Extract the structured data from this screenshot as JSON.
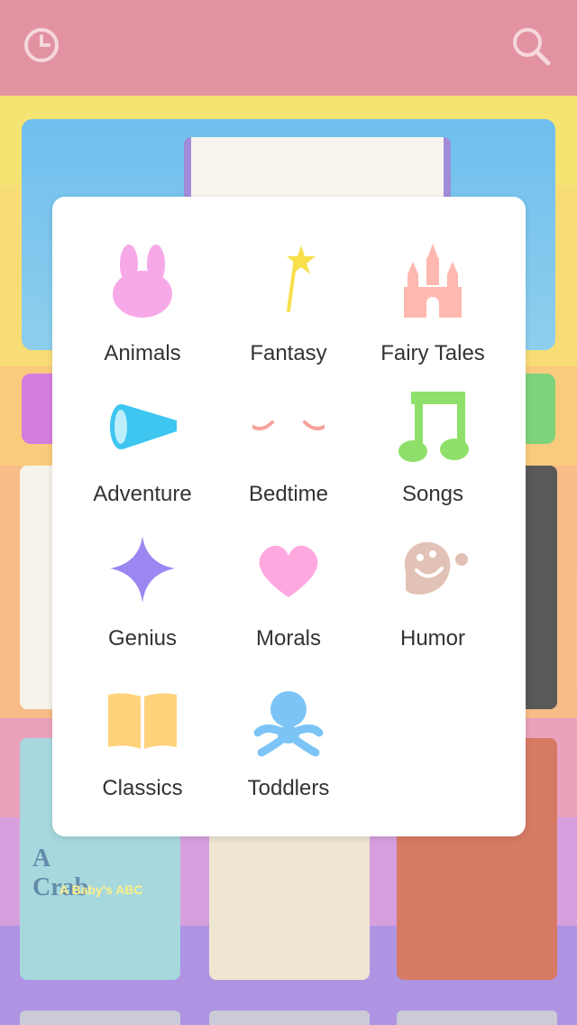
{
  "header": {
    "history_icon": "clock-icon",
    "search_icon": "search-icon"
  },
  "background": {
    "book_cover_text_1": "A",
    "book_cover_text_2": "Crab",
    "book_cover_subtitle": "A Baby's ABC"
  },
  "category_menu": {
    "items": [
      {
        "label": "Animals",
        "icon": "bunny-icon",
        "color": "#f7a8e8"
      },
      {
        "label": "Fantasy",
        "icon": "magic-wand-icon",
        "color": "#f7e04a"
      },
      {
        "label": "Fairy Tales",
        "icon": "castle-icon",
        "color": "#ffb8b0"
      },
      {
        "label": "Adventure",
        "icon": "spyglass-icon",
        "color": "#3ec6f0"
      },
      {
        "label": "Bedtime",
        "icon": "closed-eyes-icon",
        "color": "#f5a29a"
      },
      {
        "label": "Songs",
        "icon": "music-note-icon",
        "color": "#8ee06a"
      },
      {
        "label": "Genius",
        "icon": "sparkle-icon",
        "color": "#9b86f2"
      },
      {
        "label": "Morals",
        "icon": "heart-icon",
        "color": "#ffa8e0"
      },
      {
        "label": "Humor",
        "icon": "laughing-face-icon",
        "color": "#e2c2b6"
      },
      {
        "label": "Classics",
        "icon": "open-book-icon",
        "color": "#ffd27c"
      },
      {
        "label": "Toddlers",
        "icon": "toddler-icon",
        "color": "#7cc4f6"
      }
    ]
  }
}
